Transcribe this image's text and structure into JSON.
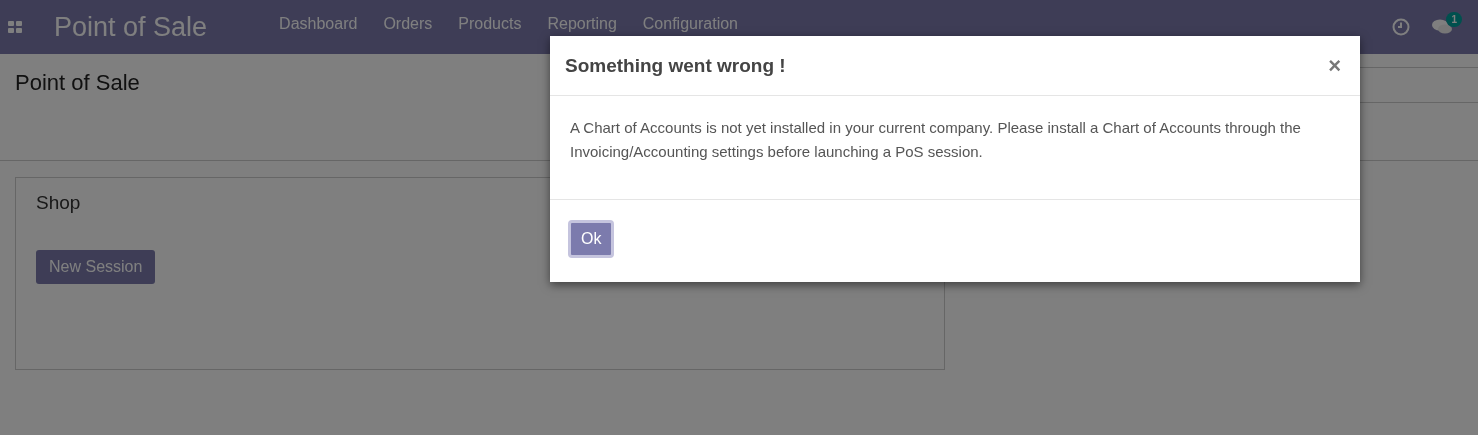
{
  "navbar": {
    "brand": "Point of Sale",
    "menu": [
      "Dashboard",
      "Orders",
      "Products",
      "Reporting",
      "Configuration"
    ],
    "messages_badge": "1"
  },
  "breadcrumb": "Point of Sale",
  "cards": [
    {
      "title": "Shop",
      "button": "New Session"
    }
  ],
  "dialog": {
    "title": "Something went wrong !",
    "close": "×",
    "message": "A Chart of Accounts is not yet installed in your current company. Please install a Chart of Accounts through the Invoicing/Accounting settings before launching a PoS session.",
    "buttons": [
      "Ok"
    ]
  }
}
